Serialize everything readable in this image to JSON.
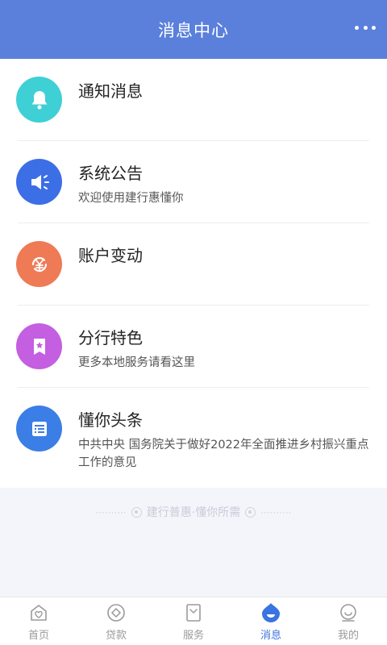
{
  "header": {
    "title": "消息中心",
    "more_icon": "more-dots-icon"
  },
  "messages": [
    {
      "name": "通知消息",
      "desc": "",
      "icon": "bell-icon",
      "color": "#3fd0d6"
    },
    {
      "name": "系统公告",
      "desc": "欢迎使用建行惠懂你",
      "icon": "megaphone-icon",
      "color": "#3c6ee6"
    },
    {
      "name": "账户变动",
      "desc": "",
      "icon": "yuan-exchange-icon",
      "color": "#ef7a56"
    },
    {
      "name": "分行特色",
      "desc": "更多本地服务请看这里",
      "icon": "bookmark-star-icon",
      "color": "#c35fe0"
    },
    {
      "name": "懂你头条",
      "desc": "中共中央 国务院关于做好2022年全面推进乡村振兴重点工作的意见",
      "icon": "news-icon",
      "color": "#3b7ee6"
    }
  ],
  "footer": {
    "slogan": "建行普惠·懂你所需"
  },
  "tabs": [
    {
      "label": "首页",
      "icon": "home-icon",
      "active": false
    },
    {
      "label": "贷款",
      "icon": "loan-icon",
      "active": false
    },
    {
      "label": "服务",
      "icon": "service-icon",
      "active": false
    },
    {
      "label": "消息",
      "icon": "message-icon",
      "active": true
    },
    {
      "label": "我的",
      "icon": "profile-icon",
      "active": false
    }
  ],
  "colors": {
    "header": "#5a80dc",
    "active_tab": "#3b73e0"
  }
}
